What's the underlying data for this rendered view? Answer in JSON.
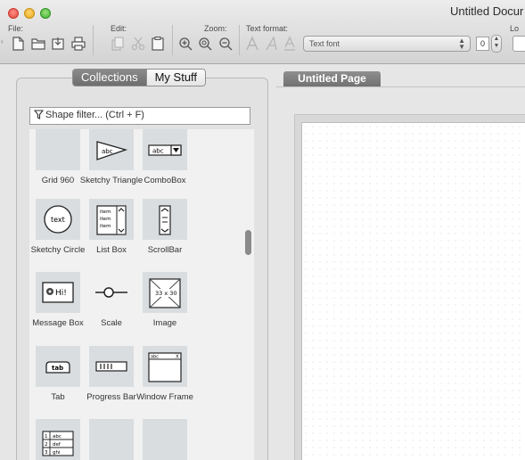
{
  "window": {
    "title": "Untitled Docur"
  },
  "toolbar": {
    "file_label": "File:",
    "edit_label": "Edit:",
    "zoom_label": "Zoom:",
    "text_format_label": "Text format:",
    "partial_label": "Lo",
    "font_value": "Text font",
    "font_size_value": "0"
  },
  "sidebar": {
    "tabs": [
      {
        "label": "Collections",
        "active": true
      },
      {
        "label": "My Stuff",
        "active": false
      }
    ],
    "filter_placeholder": "Shape filter... (Ctrl + F)",
    "shapes": [
      {
        "label": "Grid 960",
        "icon": "grid-icon"
      },
      {
        "label": "Sketchy Triangle",
        "icon": "triangle-icon"
      },
      {
        "label": "ComboBox",
        "icon": "combobox-icon"
      },
      {
        "label": "Sketchy Circle",
        "icon": "circle-icon"
      },
      {
        "label": "List Box",
        "icon": "listbox-icon"
      },
      {
        "label": "ScrollBar",
        "icon": "scrollbar-icon"
      },
      {
        "label": "Message Box",
        "icon": "message-box-icon"
      },
      {
        "label": "Scale",
        "icon": "scale-icon"
      },
      {
        "label": "Image",
        "icon": "image-icon"
      },
      {
        "label": "Tab",
        "icon": "tab-icon"
      },
      {
        "label": "Progress Bar",
        "icon": "progress-bar-icon"
      },
      {
        "label": "Window Frame",
        "icon": "window-frame-icon"
      },
      {
        "label": "",
        "icon": "data-grid-icon"
      },
      {
        "label": "",
        "icon": "blank-icon"
      },
      {
        "label": "",
        "icon": "blank-icon"
      }
    ],
    "icon_text": {
      "triangle": "abc",
      "combobox": "abc",
      "circle": "text",
      "listbox_items": [
        "item",
        "item",
        "item"
      ],
      "message": "Hi!",
      "image_size": "33 x 30",
      "tab": "tab",
      "window_title": "abc",
      "window_close": "X",
      "grid_rows": [
        "1",
        "2",
        "3"
      ],
      "grid_cells": [
        "abc",
        "def",
        "ghi"
      ]
    }
  },
  "canvas": {
    "page_tab": "Untitled Page"
  },
  "colors": {
    "close": "#e0453a",
    "minimize": "#e4a417",
    "maximize": "#3fae2d",
    "tile": "#d9dde0"
  }
}
